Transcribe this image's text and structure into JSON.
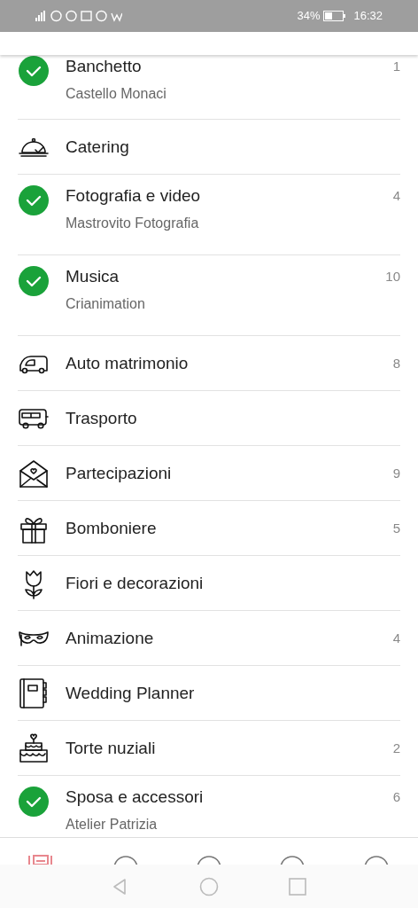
{
  "status_bar": {
    "battery": "34%",
    "time": "16:32"
  },
  "categories": [
    {
      "title": "Banchetto",
      "subtitle": "Castello Monaci",
      "count": "1",
      "done": true
    },
    {
      "title": "Catering",
      "done": false,
      "kind": "cloche"
    },
    {
      "title": "Fotografia e video",
      "subtitle": "Mastrovito Fotografia",
      "count": "4",
      "done": true
    },
    {
      "title": "Musica",
      "subtitle": "Crianimation",
      "count": "10",
      "done": true
    },
    {
      "title": "Auto matrimonio",
      "count": "8",
      "done": false,
      "kind": "car"
    },
    {
      "title": "Trasporto",
      "done": false,
      "kind": "bus"
    },
    {
      "title": "Partecipazioni",
      "count": "9",
      "done": false,
      "kind": "envelope"
    },
    {
      "title": "Bomboniere",
      "count": "5",
      "done": false,
      "kind": "gift"
    },
    {
      "title": "Fiori e decorazioni",
      "done": false,
      "kind": "flower"
    },
    {
      "title": "Animazione",
      "count": "4",
      "done": false,
      "kind": "mask"
    },
    {
      "title": "Wedding Planner",
      "done": false,
      "kind": "planner"
    },
    {
      "title": "Torte nuziali",
      "count": "2",
      "done": false,
      "kind": "cake"
    },
    {
      "title": "Sposa e accessori",
      "subtitle": "Atelier Patrizia",
      "count": "6",
      "done": true
    }
  ],
  "bottom_nav": [
    {
      "selected": true
    },
    {
      "selected": false
    },
    {
      "selected": false
    },
    {
      "selected": false
    },
    {
      "selected": false
    }
  ]
}
